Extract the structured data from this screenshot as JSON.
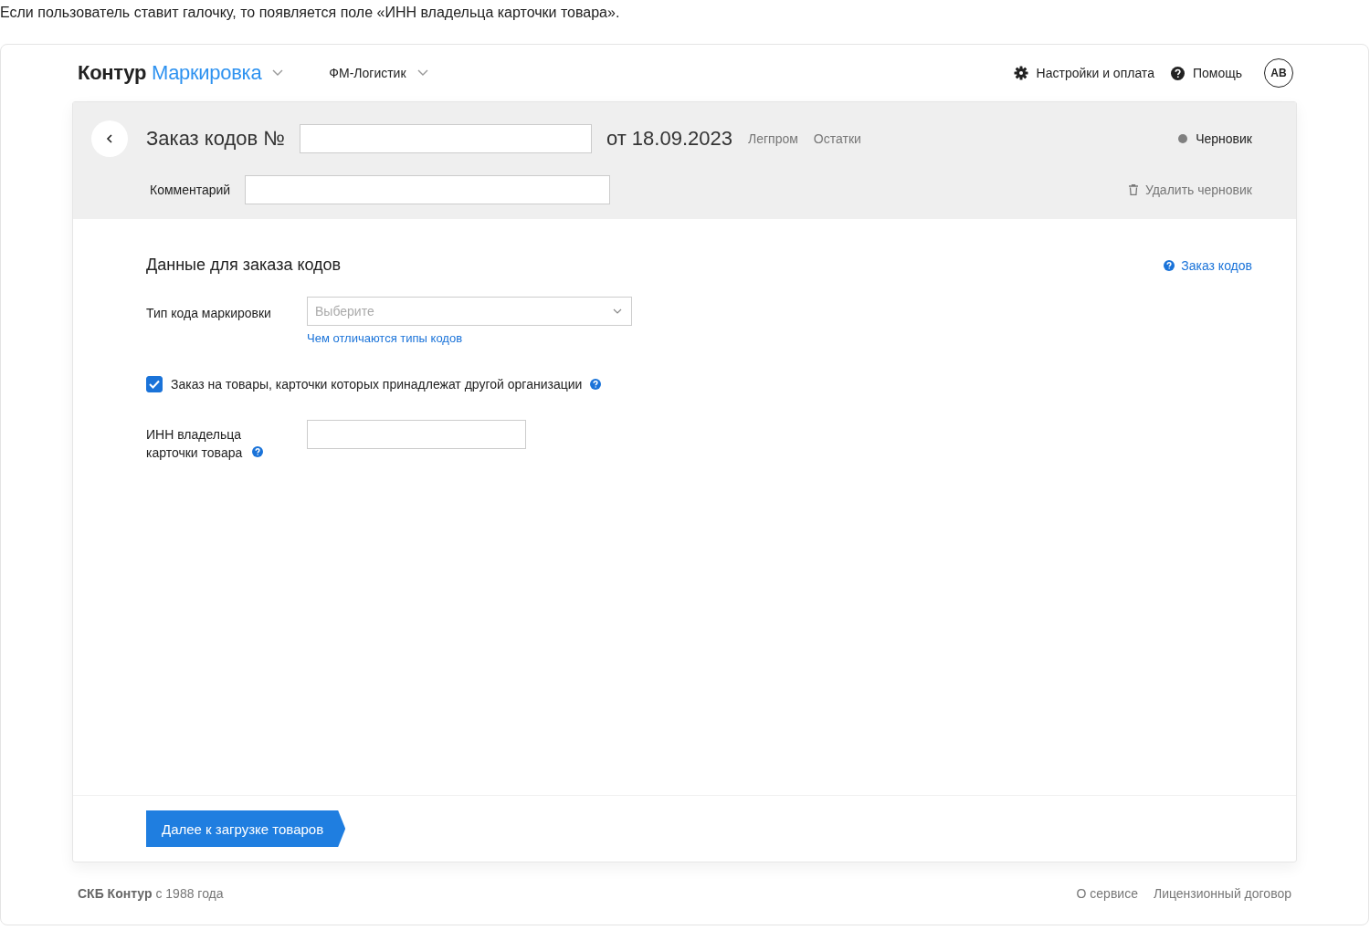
{
  "caption": "Если пользователь ставит галочку, то появляется поле «ИНН владельца карточки товара».",
  "header": {
    "logo_dark": "Контур",
    "logo_accent": "Маркировка",
    "organization": "ФМ-Логистик",
    "settings": "Настройки и оплата",
    "help": "Помощь",
    "avatar": "АВ"
  },
  "order": {
    "title": "Заказ кодов №",
    "date": "от 18.09.2023",
    "tags": [
      "Легпром",
      "Остатки"
    ],
    "status": {
      "label": "Черновик",
      "color": "#808080"
    },
    "comment_label": "Комментарий",
    "delete": "Удалить черновик"
  },
  "form": {
    "heading": "Данные для заказа кодов",
    "help_link": "Заказ кодов",
    "code_type_label": "Тип кода маркировки",
    "code_type_placeholder": "Выберите",
    "code_type_link": "Чем отличаются типы кодов",
    "other_org": {
      "label": "Заказ на товары, карточки которых принадлежат другой организации",
      "checked": true
    },
    "inn_label": "ИНН владельца карточки товара"
  },
  "next_button": "Далее к загрузке товаров",
  "footer": {
    "copyright": "**СКБ Контур** с 1988 года",
    "links": [
      "О сервисе",
      "Лицензионный договор"
    ]
  }
}
